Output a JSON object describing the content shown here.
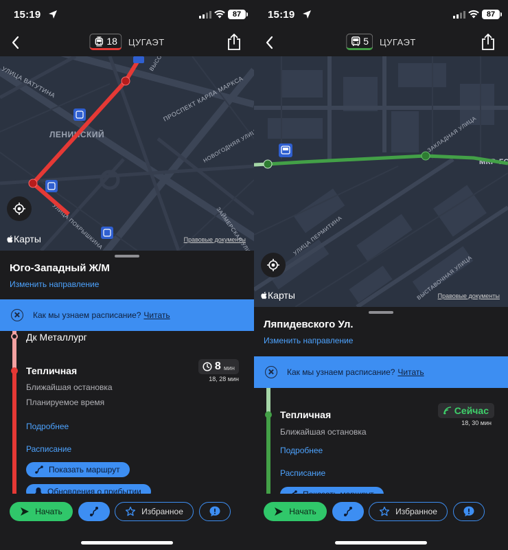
{
  "left": {
    "status": {
      "time": "15:19",
      "battery": "87"
    },
    "nav": {
      "route_number": "18",
      "route_name": "ЦУГАЭТ"
    },
    "map": {
      "labels": [
        "ЛЕНИНСКИЙ",
        "УЛИЦА ВАТУТИНА",
        "ПРОСПЕКТ КАРЛА МАРКСА",
        "ВЫСОТСКОГО",
        "НОВОГОДНЯЯ УЛИЦА",
        "ЗАЙМЕРСКАЯ УЛИЦА",
        "УЛИЦА ПОКРЫШКИНА"
      ],
      "logo": "Карты",
      "legal": "Правовые документы",
      "route_color": "#e53935"
    },
    "sheet": {
      "destination": "Юго-Западный Ж/М",
      "change_direction": "Изменить направление",
      "info_text": "Как мы узнаем расписание?",
      "info_link": "Читать",
      "prev_stop": "Дк Металлург",
      "stop": {
        "name": "Тепличная",
        "nearest": "Ближайшая остановка",
        "planned": "Планируемое время",
        "eta_value": "8",
        "eta_unit": "мин",
        "eta_next": "18, 28 мин"
      },
      "more": "Подробнее",
      "schedule": "Расписание",
      "show_route": "Показать маршрут",
      "updates": "Обновления о прибытии"
    },
    "buttons": {
      "go": "Начать",
      "favorites": "Избранное"
    }
  },
  "right": {
    "status": {
      "time": "15:19",
      "battery": "87"
    },
    "nav": {
      "route_number": "5",
      "route_name": "ЦУГАЭТ"
    },
    "map": {
      "labels": [
        "МКР-ГО",
        "УЛИЦА ПЕРМИТИНА",
        "ЗАКЛАДНАЯ УЛИЦА",
        "ВЫСТАВОЧНАЯ УЛИЦА"
      ],
      "logo": "Карты",
      "legal": "Правовые документы",
      "route_color": "#43a047"
    },
    "sheet": {
      "destination": "Ляпидевского Ул.",
      "change_direction": "Изменить направление",
      "info_text": "Как мы узнаем расписание?",
      "info_link": "Читать",
      "stop": {
        "name": "Тепличная",
        "nearest": "Ближайшая остановка",
        "eta_value": "Сейчас",
        "eta_next": "18, 30 мин"
      },
      "more": "Подробнее",
      "schedule": "Расписание",
      "show_route": "Показать маршрут"
    },
    "buttons": {
      "go": "Начать",
      "favorites": "Избранное"
    }
  }
}
